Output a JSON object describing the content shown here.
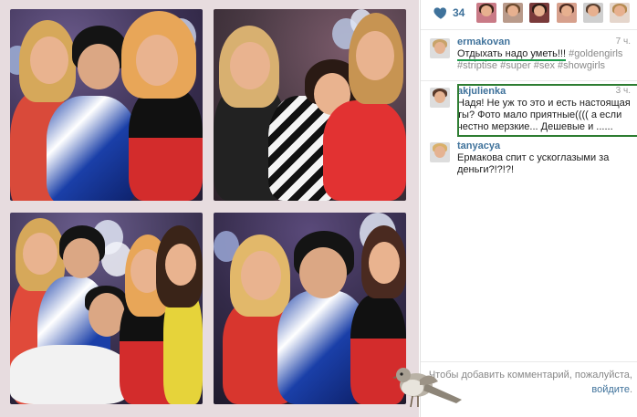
{
  "likes": {
    "count": "34",
    "icon": "heart-icon",
    "likers": [
      {
        "bg": "#c97a86",
        "hair": "#3b2418"
      },
      {
        "bg": "#b99a8a",
        "hair": "#6b4a2e"
      },
      {
        "bg": "#7a3a3a",
        "hair": "#2a1a14"
      },
      {
        "bg": "#d7a08c",
        "hair": "#4a2a20"
      },
      {
        "bg": "#cfcfcf",
        "hair": "#5a4030"
      },
      {
        "bg": "#e5d6cc",
        "hair": "#b58a50"
      }
    ]
  },
  "comments": [
    {
      "user": "ermakovan",
      "time": "7 ч.",
      "text_main": "Отдыхать надо уметь!!!",
      "hashtags_line1": "#goldengirls",
      "hashtags_line2": "#striptise #super #sex #showgirls",
      "avatar_hair": "#c8a36a"
    },
    {
      "user": "akjulienka",
      "time": "3 ч.",
      "text": "Надя! Не уж то это и есть настоящая ты? Фото мало приятные(((( а если честно мерзкие... Дешевые и ......",
      "avatar_hair": "#5a3a2a"
    },
    {
      "user": "tanyacya",
      "time": "",
      "text": "Ермакова спит с ускоглазыми за деньги?!?!?!",
      "avatar_hair": "#d9b06a"
    }
  ],
  "login": {
    "text": "Чтобы добавить комментарий, пожалуйста,",
    "link": "войдите",
    "period": "."
  },
  "colors": {
    "link": "#3f729b",
    "highlight_box": "#2e7d32",
    "underline": "#1a9a4a"
  }
}
